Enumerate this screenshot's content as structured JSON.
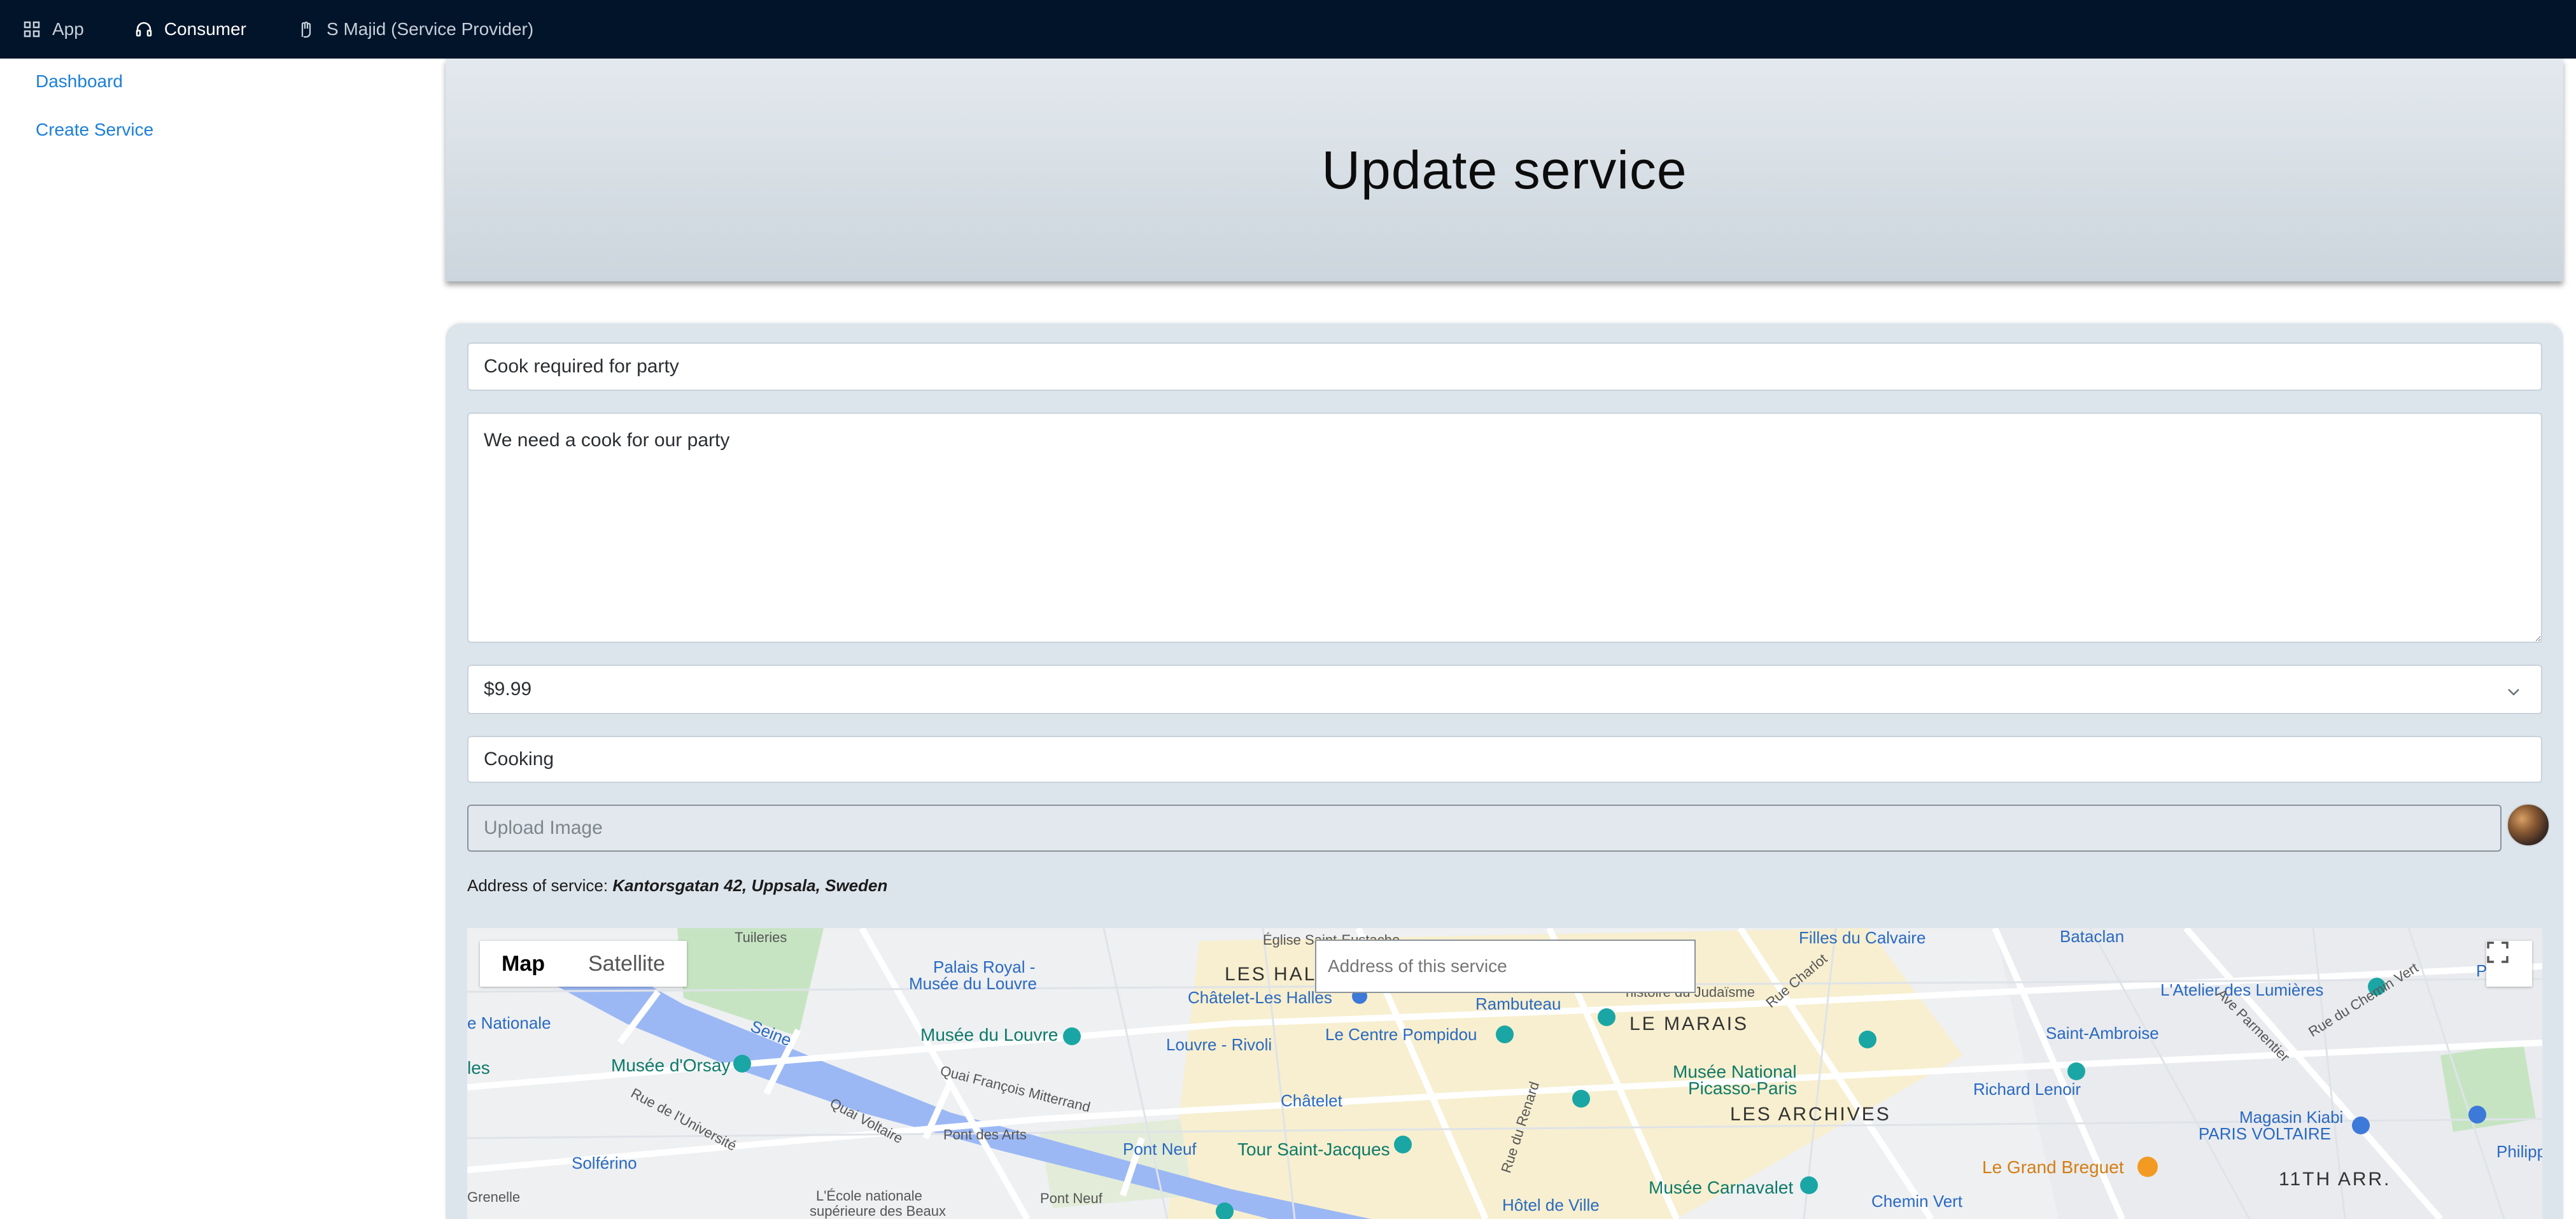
{
  "nav": {
    "app_label": "App",
    "consumer_label": "Consumer",
    "provider_label": "S Majid (Service Provider)"
  },
  "sidebar": {
    "items": [
      {
        "label": "Dashboard"
      },
      {
        "label": "Create Service"
      }
    ]
  },
  "page": {
    "title": "Update service"
  },
  "form": {
    "title_value": "Cook required for party",
    "description_value": "We need a cook for our party",
    "price_value": "$9.99",
    "category_value": "Cooking",
    "upload_placeholder": "Upload Image",
    "address_label": "Address of service:",
    "address_value": "Kantorsgatan 42, Uppsala, Sweden"
  },
  "map": {
    "map_tab": "Map",
    "satellite_tab": "Satellite",
    "search_placeholder": "Address of this service",
    "labels": {
      "tuileries": "Tuileries",
      "palais_royal": "Palais Royal -",
      "palais_royal2": "Musée du Louvre",
      "eglise": "Église Saint-Eustache",
      "chatelet_halles": "Châtelet-Les Halles",
      "les_halles": "LES HALL",
      "rambuteau": "Rambuteau",
      "judaisme": "histoire du Judaïsme",
      "filles_calvaire": "Filles du Calvaire",
      "bataclan": "Bataclan",
      "atelier_lumieres": "L'Atelier des Lumières",
      "pere": "Père",
      "nationale": "e Nationale",
      "seine": "Seine",
      "musee_louvre": "Musée du Louvre",
      "louvre_rivoli": "Louvre - Rivoli",
      "centre_pompidou": "Le Centre Pompidou",
      "le_marais": "LE MARAIS",
      "rue_charlot": "Rue Charlot",
      "saint_ambroise": "Saint-Ambroise",
      "ave_parmentier": "Ave Parmentier",
      "rue_chemin_vert": "Rue du Chemin Vert",
      "musee_orsay": "Musée d'Orsay",
      "les": "les",
      "quai_mitterrand": "Quai François Mitterrand",
      "chatelet": "Châtelet",
      "musee_picasso": "Musée National",
      "musee_picasso2": "Picasso-Paris",
      "richard_lenoir": "Richard Lenoir",
      "rue_universite": "Rue de l'Université",
      "quai_voltaire": "Quai Voltaire",
      "pont_arts": "Pont des Arts",
      "les_archives": "LES ARCHIVES",
      "magasin_kiabi": "Magasin Kiabi",
      "paris_voltaire": "PARIS VOLTAIRE",
      "solferino": "Solférino",
      "pont_neuf_m": "Pont Neuf",
      "tour_st_jacques": "Tour Saint-Jacques",
      "rue_renard": "Rue du Renard",
      "grand_breguet": "Le Grand Breguet",
      "philippe": "Philippe",
      "grenelle": "Grenelle",
      "ecole": "L'École nationale",
      "ecole2": "supérieure des Beaux",
      "pont_neuf": "Pont Neuf",
      "hotel_ville": "Hôtel de Ville",
      "musee_carnavalet": "Musée Carnavalet",
      "chemin_vert": "Chemin Vert",
      "eleventh": "11TH ARR."
    }
  }
}
